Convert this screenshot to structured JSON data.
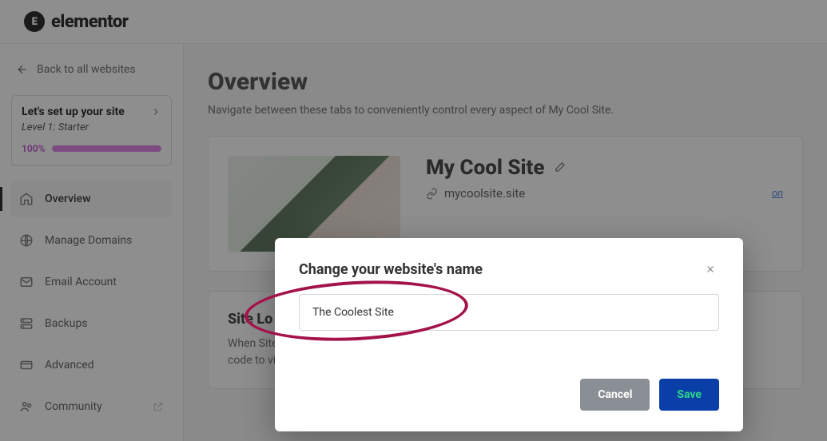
{
  "brand": {
    "name": "elementor",
    "mark": "E"
  },
  "sidebar": {
    "back_label": "Back to all websites",
    "setup": {
      "title": "Let's set up your site",
      "level": "Level 1: Starter",
      "percent": "100%"
    },
    "items": [
      {
        "label": "Overview"
      },
      {
        "label": "Manage Domains"
      },
      {
        "label": "Email Account"
      },
      {
        "label": "Backups"
      },
      {
        "label": "Advanced"
      },
      {
        "label": "Community"
      }
    ]
  },
  "main": {
    "heading": "Overview",
    "subtitle": "Navigate between these tabs to conveniently control every aspect of My Cool Site."
  },
  "site": {
    "name": "My Cool Site",
    "url": "mycoolsite.site",
    "question_link": "on"
  },
  "lock": {
    "title": "Site Lo",
    "body_line1": "When Site ",
    "body_line2": "code to vie"
  },
  "modal": {
    "title": "Change your website's name",
    "input_value": "The Coolest Site",
    "cancel": "Cancel",
    "save": "Save"
  }
}
